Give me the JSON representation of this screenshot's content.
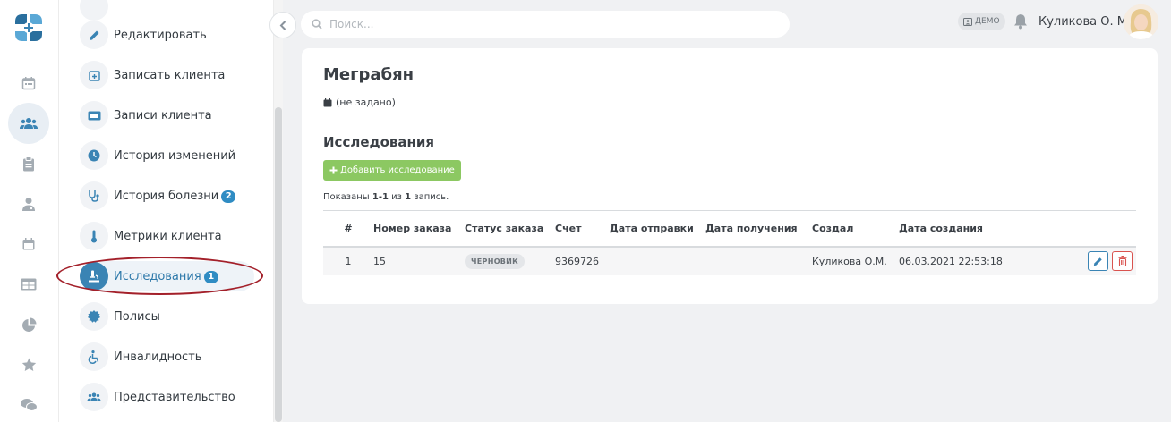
{
  "search": {
    "placeholder": "Поиск..."
  },
  "header": {
    "demo_label": "ДЕМО",
    "user_name": "Куликова О. М."
  },
  "rail": {
    "items": [
      "calendar-icon",
      "users-icon",
      "clipboard-icon",
      "doctor-icon",
      "calendar-alt-icon",
      "table-icon",
      "pie-chart-icon",
      "star-icon",
      "chat-icon"
    ],
    "active": "users-icon"
  },
  "submenu": {
    "items": [
      {
        "label": "Редактировать",
        "icon": "pencil-icon"
      },
      {
        "label": "Записать клиента",
        "icon": "calendar-plus-icon"
      },
      {
        "label": "Записи клиента",
        "icon": "ticket-icon"
      },
      {
        "label": "История изменений",
        "icon": "clock-icon"
      },
      {
        "label": "История болезни",
        "icon": "stethoscope-icon",
        "badge": "2"
      },
      {
        "label": "Метрики клиента",
        "icon": "thermometer-icon"
      },
      {
        "label": "Исследования",
        "icon": "microscope-icon",
        "badge": "1",
        "active": true
      },
      {
        "label": "Полисы",
        "icon": "certificate-icon"
      },
      {
        "label": "Инвалидность",
        "icon": "wheelchair-icon"
      },
      {
        "label": "Представительство",
        "icon": "users-icon"
      }
    ]
  },
  "main": {
    "client_name": "Меграбян",
    "birth_date": "(не задано)",
    "section_title": "Исследования",
    "add_button": "Добавить исследование",
    "shown_prefix": "Показаны",
    "shown_range": "1-1",
    "shown_of": "из",
    "shown_total": "1",
    "shown_suffix": "запись.",
    "table": {
      "columns": [
        "#",
        "Номер заказа",
        "Статус заказа",
        "Счет",
        "Дата отправки",
        "Дата получения",
        "Создал",
        "Дата создания"
      ],
      "rows": [
        {
          "num": "1",
          "order": "15",
          "status": "ЧЕРНОВИК",
          "invoice": "9369726",
          "sent": "",
          "received": "",
          "creator": "Куликова О.М.",
          "created": "06.03.2021 22:53:18"
        }
      ]
    }
  },
  "colors": {
    "accent": "#3a84b4",
    "success": "#8cc862",
    "danger": "#d9534f",
    "highlight": "#a3202a"
  }
}
